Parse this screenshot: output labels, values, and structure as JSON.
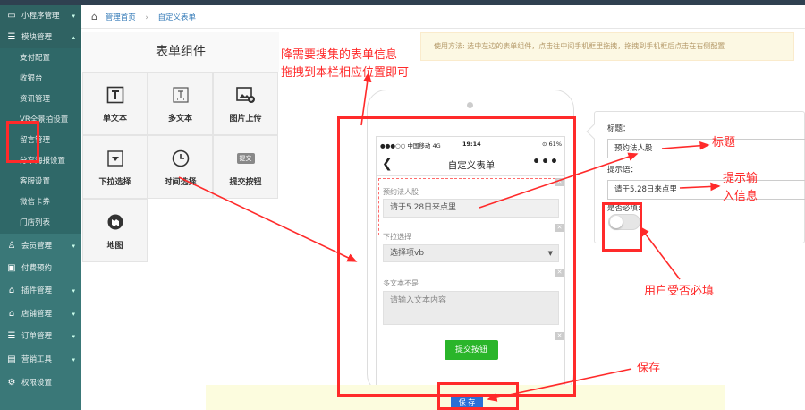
{
  "sidebar": {
    "items": [
      {
        "label": "小程序管理",
        "icon": "monitor-icon"
      },
      {
        "label": "模块管理",
        "icon": "list-icon"
      },
      {
        "label": "会员管理",
        "icon": "user-icon"
      },
      {
        "label": "付费预约",
        "icon": "card-icon"
      },
      {
        "label": "插件管理",
        "icon": "home-icon"
      },
      {
        "label": "店铺管理",
        "icon": "home-icon"
      },
      {
        "label": "订单管理",
        "icon": "list-icon"
      },
      {
        "label": "营销工具",
        "icon": "briefcase-icon"
      },
      {
        "label": "权限设置",
        "icon": "gear-icon"
      }
    ],
    "sub_items": [
      "支付配置",
      "收银台",
      "资讯管理",
      "VR全景拍设置",
      "留言管理",
      "分享海报设置",
      "客服设置",
      "微信卡券",
      "门店列表"
    ]
  },
  "breadcrumb": {
    "home": "管理首页",
    "current": "自定义表单"
  },
  "components": {
    "title": "表单组件",
    "items": [
      {
        "label": "单文本",
        "icon": "text-t-icon"
      },
      {
        "label": "多文本",
        "icon": "multitext-icon"
      },
      {
        "label": "图片上传",
        "icon": "image-upload-icon"
      },
      {
        "label": "下拉选择",
        "icon": "dropdown-icon"
      },
      {
        "label": "时间选择",
        "icon": "clock-icon"
      },
      {
        "label": "提交按钮",
        "icon": "submit-icon"
      },
      {
        "label": "地图",
        "icon": "map-icon"
      }
    ],
    "submit_icon_text": "提交"
  },
  "hint": "使用方法: 选中左边的表单组件，点击往中间手机框里拖拽，拖拽到手机框后点击在右侧配置",
  "phone": {
    "carrier": "●●●○○ 中国移动  4G",
    "time": "19:14",
    "battery": "⊙ 61%",
    "nav_title": "自定义表单",
    "back": "❮",
    "more": "•••",
    "fields": [
      {
        "label": "预约法人股",
        "value": "请于5.28日来点里"
      },
      {
        "label": "下拉选择",
        "value": "选择项vb"
      },
      {
        "label": "多文本不是",
        "placeholder": "请输入文本内容"
      }
    ],
    "submit": "提交按钮"
  },
  "config": {
    "title_label": "标题：",
    "title_value": "预约法人股",
    "hint_label": "提示语：",
    "hint_value": "请于5.28日来点里",
    "required_label": "是否必填:",
    "required": false
  },
  "save": "保 存",
  "annotations": {
    "drag_note_1": "降需要搜集的表单信息",
    "drag_note_2": "拖拽到本栏相应位置即可",
    "title": "标题",
    "hint_1": "提示输",
    "hint_2": "入信息",
    "required": "用户受否必填",
    "save": "保存"
  },
  "colors": {
    "sidebar": "#3a7878",
    "annotation": "#ff2a2a",
    "save": "#2a6fd6",
    "submit": "#2ab52a"
  }
}
